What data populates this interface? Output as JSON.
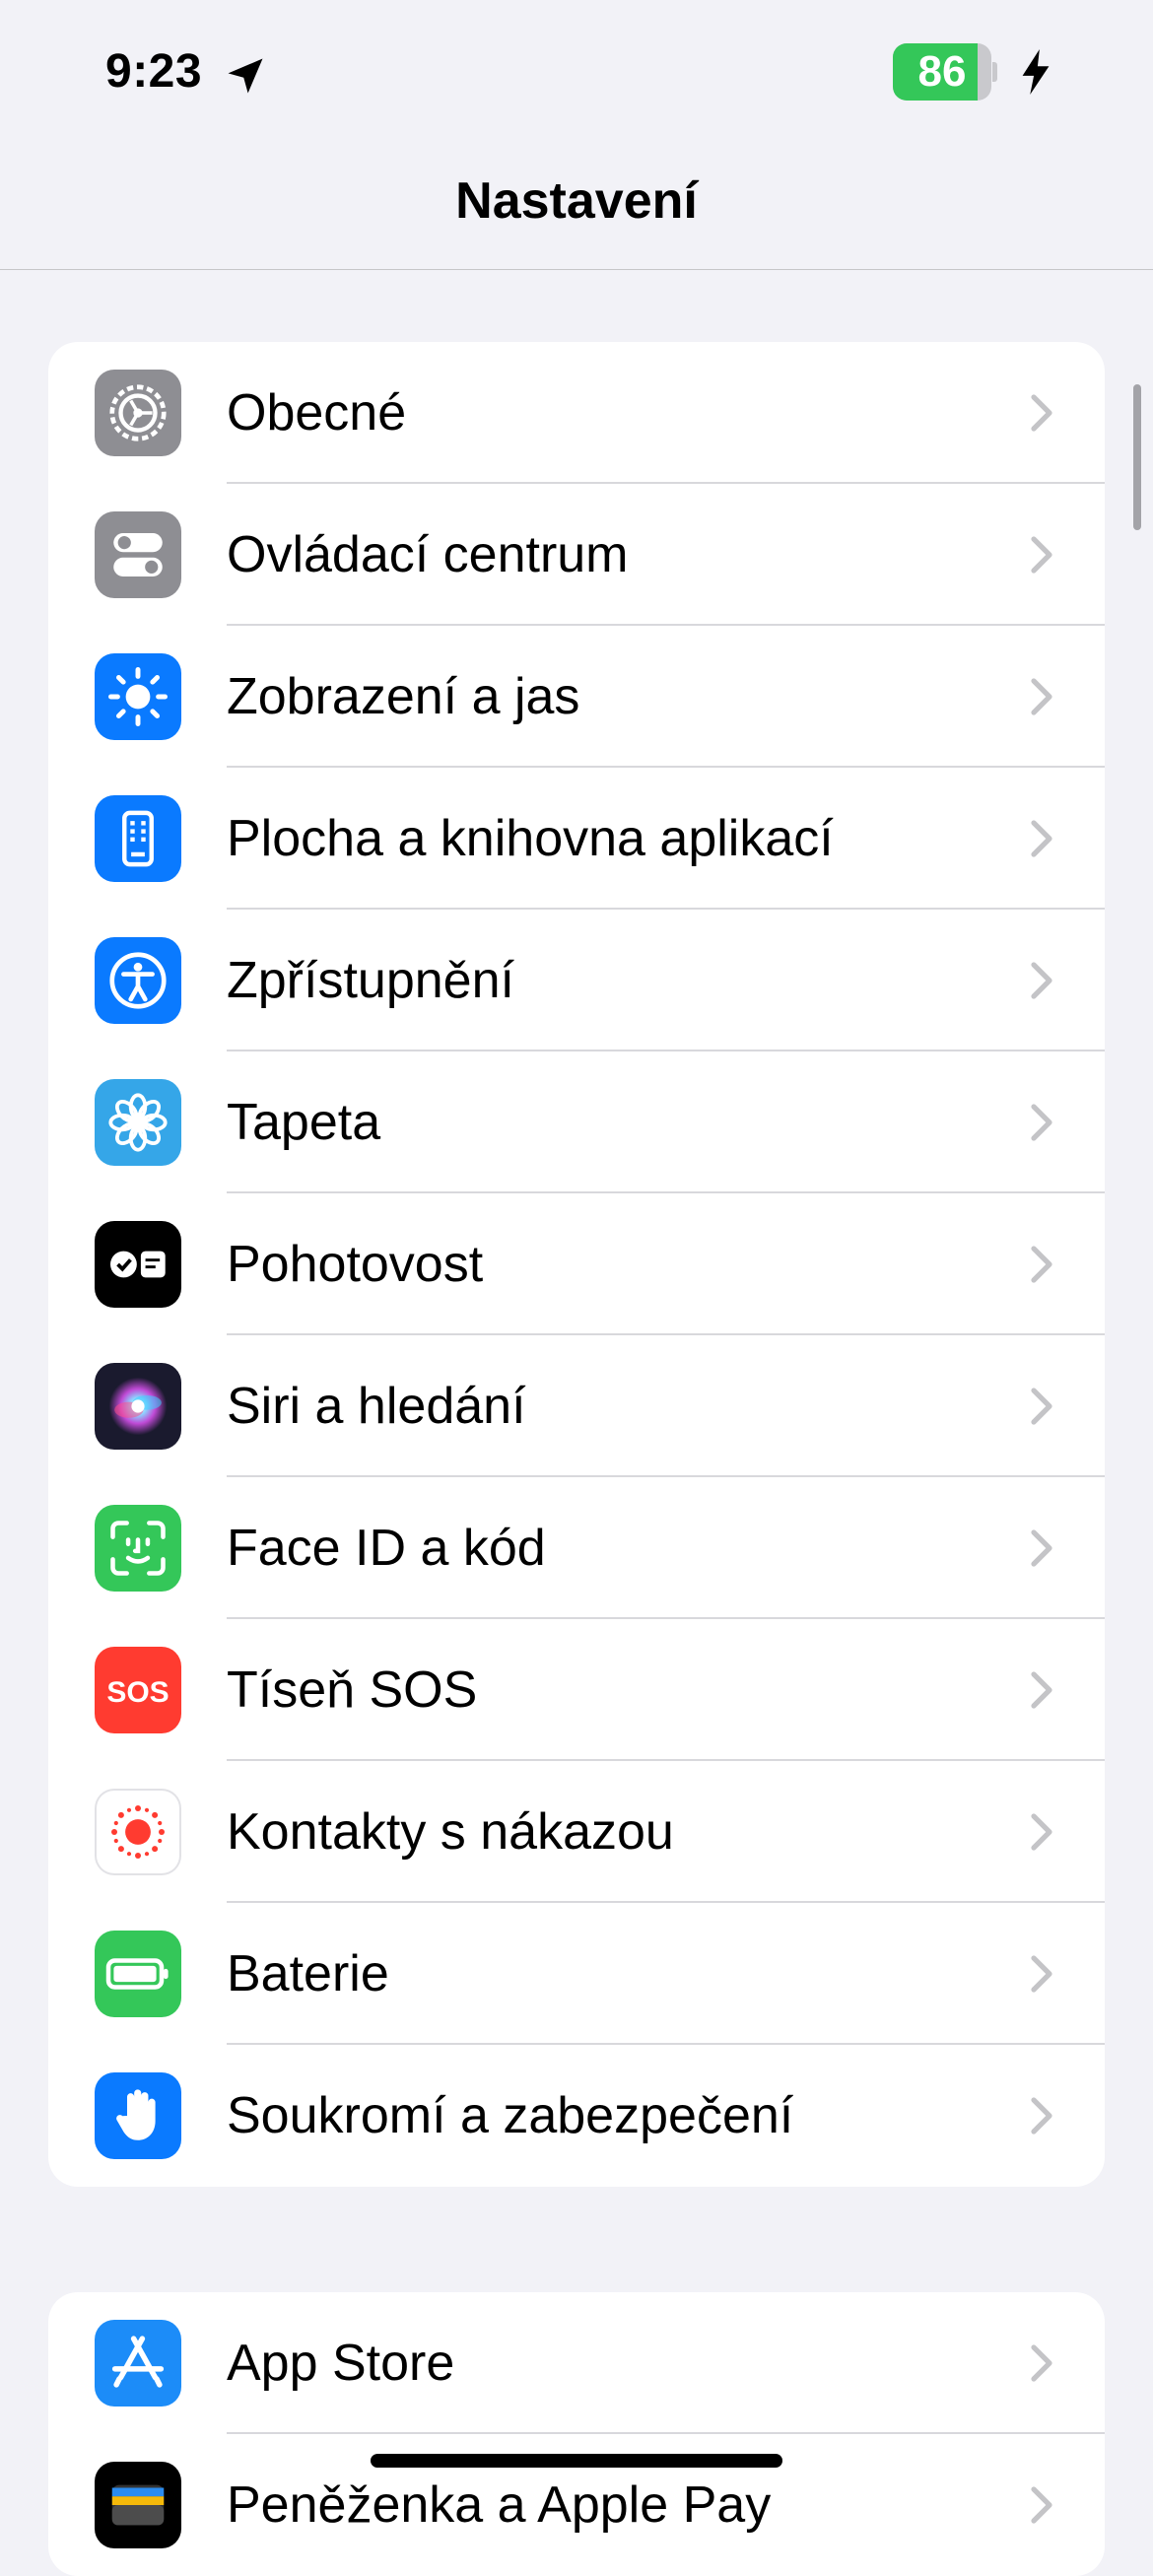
{
  "status_bar": {
    "time": "9:23",
    "battery_percent": "86",
    "battery_level": 0.86,
    "battery_color": "#34c759",
    "charging": true
  },
  "nav": {
    "title": "Nastavení"
  },
  "groups": [
    {
      "items": [
        {
          "label": "Obecné",
          "icon": "gear-icon",
          "color": "#8e8e93"
        },
        {
          "label": "Ovládací centrum",
          "icon": "switches-icon",
          "color": "#8e8e93"
        },
        {
          "label": "Zobrazení a jas",
          "icon": "sun-icon",
          "color": "#0a7aff"
        },
        {
          "label": "Plocha a knihovna aplikací",
          "icon": "home-screen-icon",
          "color": "#0a7aff"
        },
        {
          "label": "Zpřístupnění",
          "icon": "accessibility-icon",
          "color": "#0a7aff"
        },
        {
          "label": "Tapeta",
          "icon": "flower-icon",
          "color": "#35a6e8"
        },
        {
          "label": "Pohotovost",
          "icon": "standby-icon",
          "color": "#000000"
        },
        {
          "label": "Siri a hledání",
          "icon": "siri-icon",
          "color": "#1a1a2e"
        },
        {
          "label": "Face ID a kód",
          "icon": "face-id-icon",
          "color": "#34c759"
        },
        {
          "label": "Tíseň SOS",
          "icon": "sos-icon",
          "color": "#ff3b30"
        },
        {
          "label": "Kontakty s nákazou",
          "icon": "exposure-icon",
          "color": "#ffffff"
        },
        {
          "label": "Baterie",
          "icon": "battery-icon",
          "color": "#34c759"
        },
        {
          "label": "Soukromí a zabezpečení",
          "icon": "hand-icon",
          "color": "#0a7aff"
        }
      ]
    },
    {
      "items": [
        {
          "label": "App Store",
          "icon": "app-store-icon",
          "color": "#1c8cf8"
        },
        {
          "label": "Peněženka a Apple Pay",
          "icon": "wallet-icon",
          "color": "#000000"
        }
      ]
    }
  ]
}
